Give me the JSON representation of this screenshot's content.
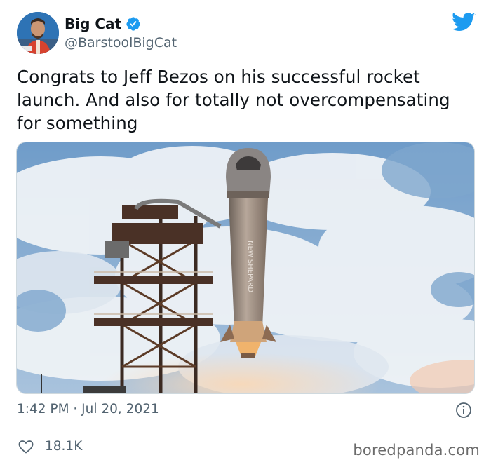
{
  "author": {
    "display_name": "Big Cat",
    "handle": "@BarstoolBigCat",
    "verified": true
  },
  "tweet": {
    "text": "Congrats to Jeff Bezos on his successful rocket launch. And also for totally not overcompensating for something",
    "timestamp": "1:42 PM · Jul 20, 2021",
    "like_count": "18.1K"
  },
  "icons": {
    "brand": "twitter-bird-icon",
    "verified": "verified-badge-icon",
    "info": "info-icon",
    "like": "heart-icon"
  },
  "colors": {
    "twitter_blue": "#1d9bf0",
    "secondary_text": "#536471",
    "divider": "#cfd9de"
  },
  "watermark": "boredpanda.com"
}
